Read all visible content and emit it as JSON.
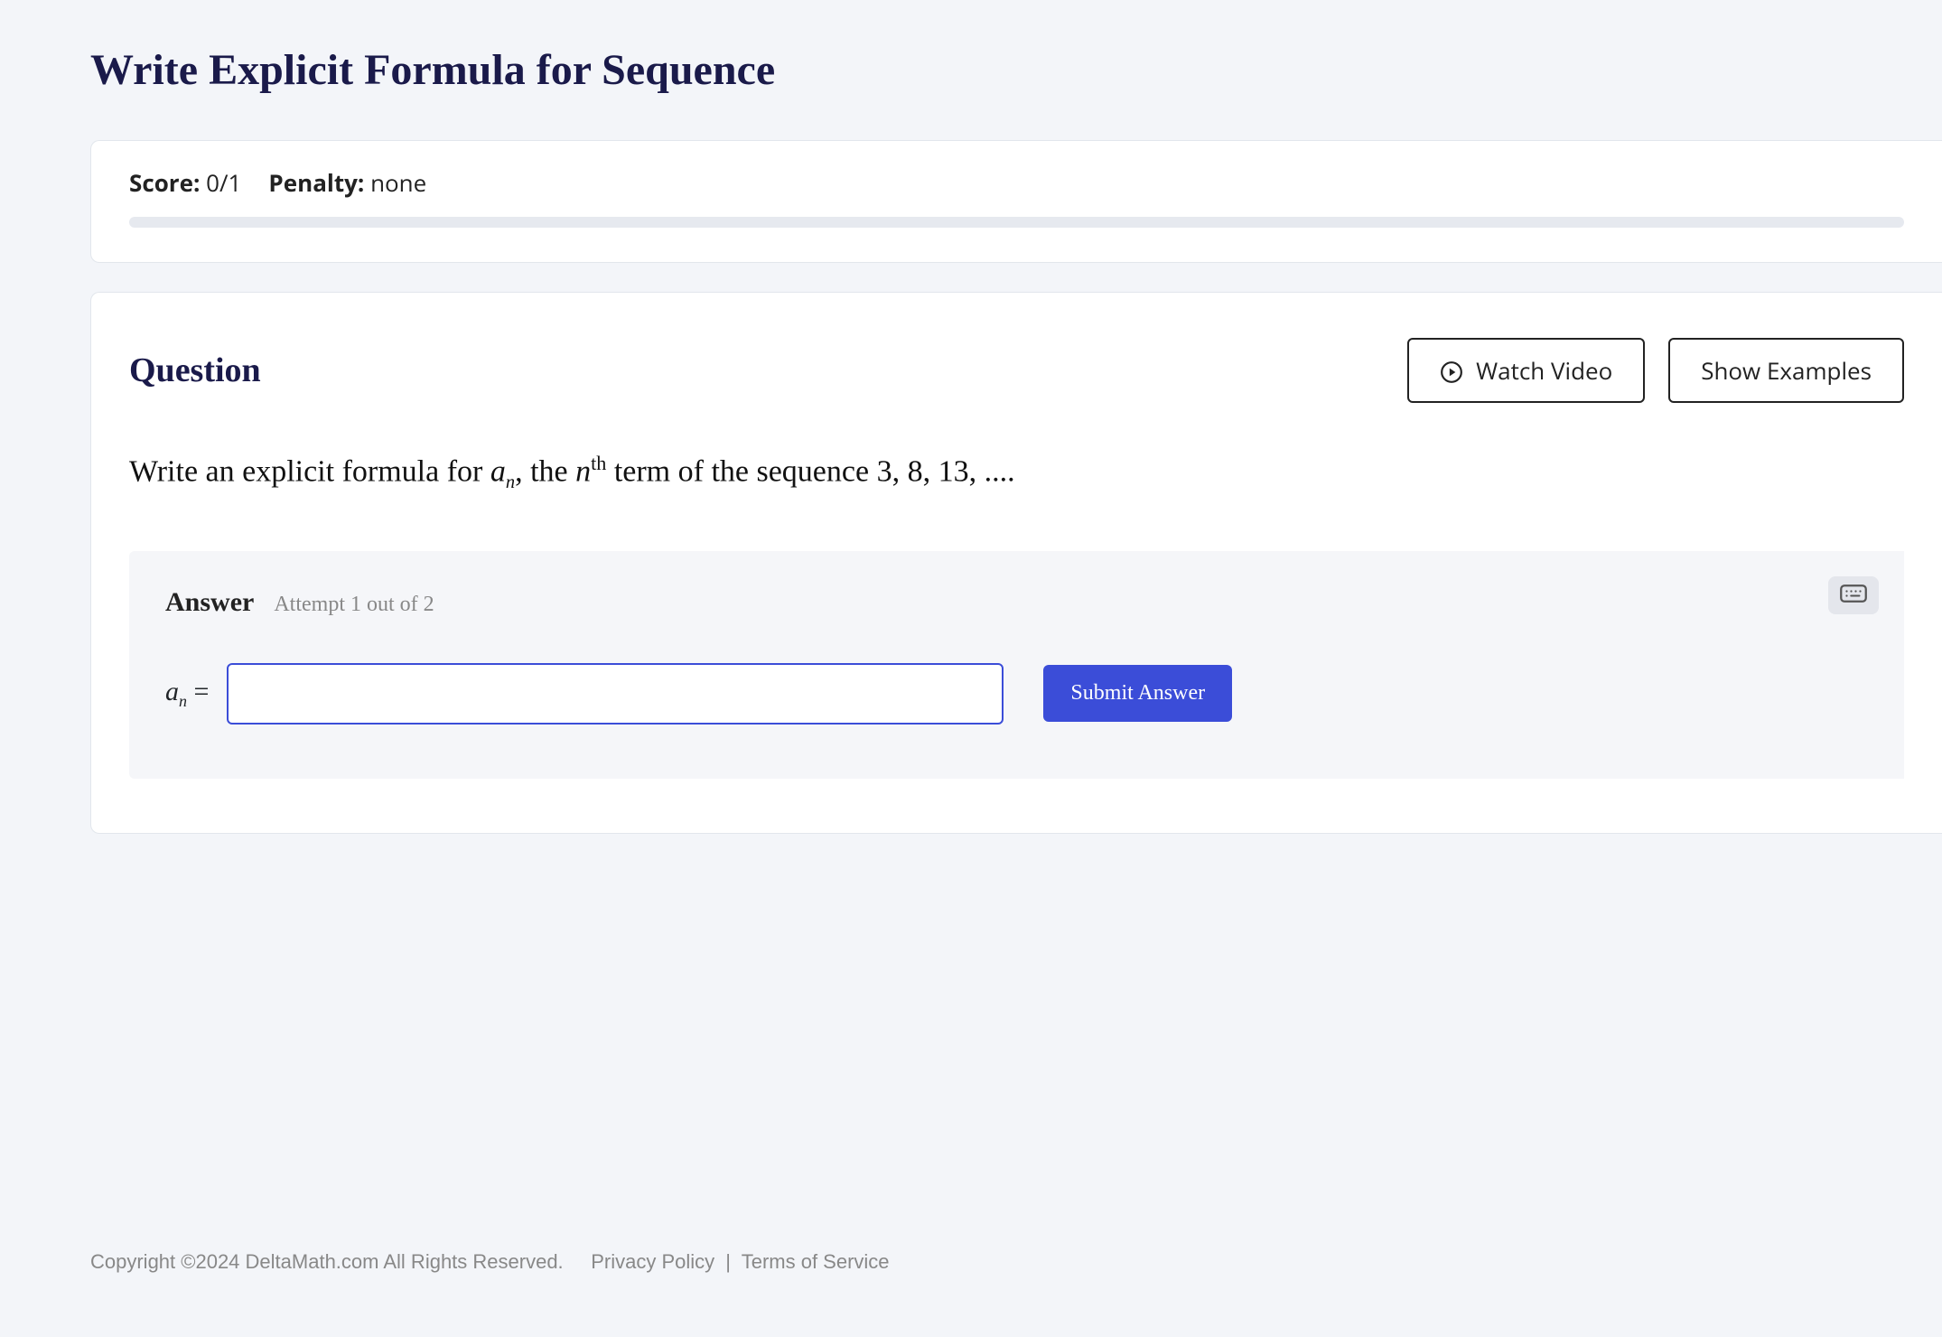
{
  "title": "Write Explicit Formula for Sequence",
  "score": {
    "label": "Score:",
    "value": "0/1"
  },
  "penalty": {
    "label": "Penalty:",
    "value": "none"
  },
  "question": {
    "heading": "Question",
    "watch_video": "Watch Video",
    "show_examples": "Show Examples",
    "prompt_lead": "Write an explicit formula for ",
    "prompt_mid": ", the ",
    "prompt_tail": " term of the sequence ",
    "sequence": "3, 8, 13, ...",
    "period": "."
  },
  "answer": {
    "label": "Answer",
    "attempt": "Attempt 1 out of 2",
    "input_value": "",
    "submit": "Submit Answer"
  },
  "footer": {
    "copyright": "Copyright ©2024 DeltaMath.com All Rights Reserved.",
    "privacy": "Privacy Policy",
    "terms": "Terms of Service"
  }
}
